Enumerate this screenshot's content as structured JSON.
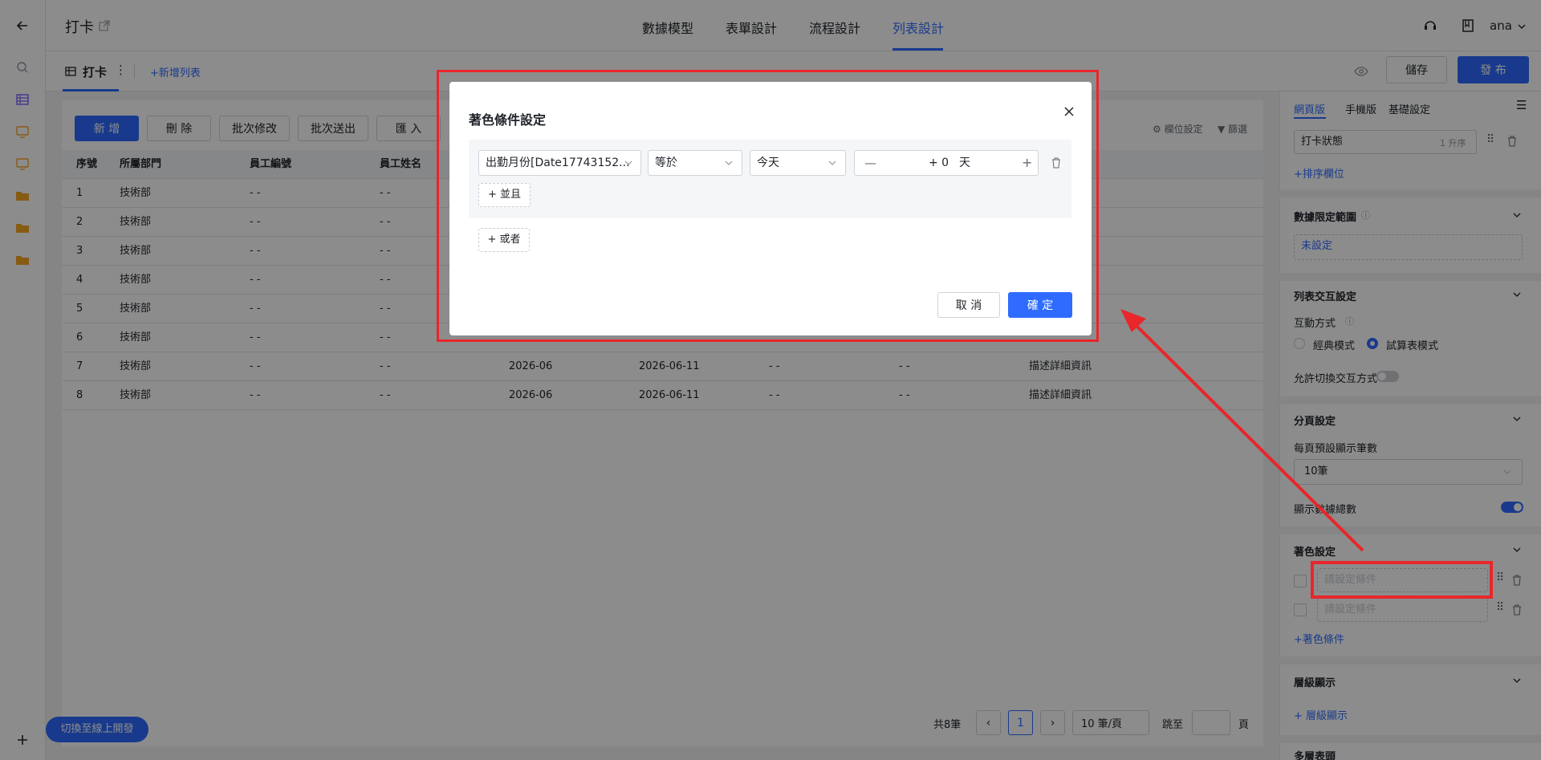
{
  "header": {
    "back_icon": "arrow-left-icon",
    "app_title": "打卡",
    "tabs": [
      {
        "label": "數據模型"
      },
      {
        "label": "表單設計"
      },
      {
        "label": "流程設計"
      },
      {
        "label": "列表設計"
      }
    ],
    "active_tab": "列表設計",
    "user": "ana"
  },
  "subbar": {
    "view_name": "打卡",
    "add_view": "+新增列表",
    "save": "儲存",
    "publish": "發 布"
  },
  "toolbar": {
    "add": "新 增",
    "delete": "刪 除",
    "batch_edit": "批次修改",
    "batch_send": "批次送出",
    "import": "匯 入",
    "column_settings": "欄位設定",
    "filter": "篩選"
  },
  "table": {
    "columns": [
      "序號",
      "所屬部門",
      "員工編號",
      "員工姓名"
    ],
    "rows": [
      [
        "1",
        "技術部",
        "- -",
        "- -"
      ],
      [
        "2",
        "技術部",
        "- -",
        "- -"
      ],
      [
        "3",
        "技術部",
        "- -",
        "- -"
      ],
      [
        "4",
        "技術部",
        "- -",
        "- -"
      ],
      [
        "5",
        "技術部",
        "- -",
        "- -"
      ],
      [
        "6",
        "技術部",
        "- -",
        "- -"
      ],
      [
        "7",
        "技術部",
        "- -",
        "- -",
        "2026-06",
        "2026-06-11",
        "- -",
        "- -",
        "描述詳細資訊"
      ],
      [
        "8",
        "技術部",
        "- -",
        "- -",
        "2026-06",
        "2026-06-11",
        "- -",
        "- -",
        "描述詳細資訊"
      ]
    ]
  },
  "pagination": {
    "total": "共8筆",
    "page": "1",
    "page_size": "10 筆/頁",
    "jump_to": "跳至",
    "page_unit": "頁"
  },
  "switch_online": "切換至線上開發",
  "right_panel": {
    "tabs": [
      "網頁版",
      "手機版",
      "基礎設定"
    ],
    "sort_field": "打卡狀態",
    "sort_order": "1 升序",
    "add_sort": "+排序欄位",
    "data_scope_title": "數據限定範圍",
    "data_scope_value": "未設定",
    "interaction_title": "列表交互設定",
    "interaction_mode_label": "互動方式",
    "mode_classic": "經典模式",
    "mode_sheet": "試算表模式",
    "allow_switch": "允許切換交互方式",
    "paging_title": "分頁設定",
    "page_default_label": "每頁預設顯示筆數",
    "page_default_value": "10筆",
    "show_total_label": "顯示數據總數",
    "coloring_title": "著色設定",
    "coloring_placeholder_1": "請設定條件",
    "coloring_placeholder_2": "請設定條件",
    "add_coloring": "+著色條件",
    "hierarchy_title": "層級顯示",
    "add_hierarchy": "+ 層級顯示",
    "multi_header_title": "多層表頭"
  },
  "dialog": {
    "title": "著色條件設定",
    "field": "出勤月份[Date17743152...",
    "operator": "等於",
    "value_type": "今天",
    "offset_value": "+ 0",
    "offset_unit": "天",
    "and_button": "+ 並且",
    "or_button": "+ 或者",
    "cancel": "取 消",
    "confirm": "確 定"
  },
  "colors": {
    "accent": "#2f6bff",
    "highlight": "#e8262b"
  }
}
